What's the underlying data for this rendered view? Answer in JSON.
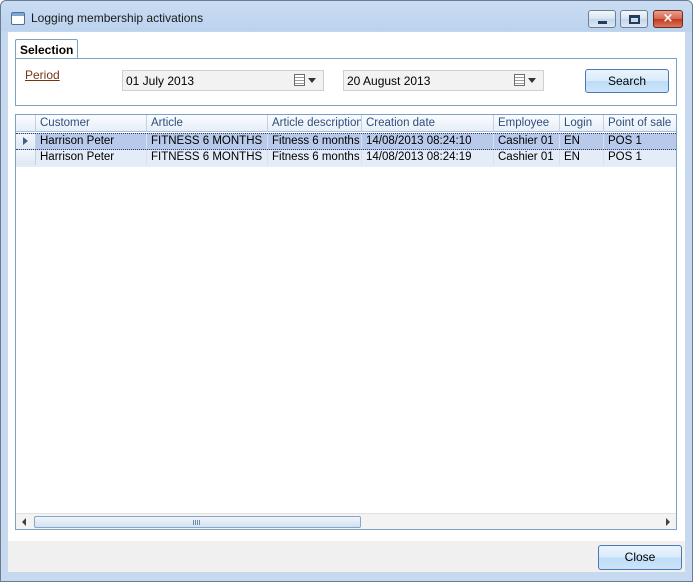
{
  "window": {
    "title": "Logging membership activations",
    "icon": "window-app-icon",
    "controls": {
      "minimize": "minimize-icon",
      "maximize": "maximize-icon",
      "close": "×"
    }
  },
  "selection": {
    "tab_label": "Selection",
    "period_label": "Period",
    "date_from": "01 July 2013",
    "date_to": "20 August 2013",
    "search_label": "Search"
  },
  "grid": {
    "columns": [
      "Customer",
      "Article",
      "Article description",
      "Creation date",
      "Employee",
      "Login",
      "Point of sale"
    ],
    "rows": [
      [
        "Harrison Peter",
        "FITNESS 6 MONTHS",
        "Fitness 6 months",
        "14/08/2013 08:24:10",
        "Cashier 01",
        "EN",
        "POS 1"
      ],
      [
        "Harrison Peter",
        "FITNESS 6 MONTHS",
        "Fitness 6 months",
        "14/08/2013 08:24:19",
        "Cashier 01",
        "EN",
        "POS 1"
      ]
    ],
    "selected_row": 0
  },
  "footer": {
    "close_label": "Close"
  },
  "colors": {
    "selection_row": "#b9c9ea",
    "alt_row": "#e4ecf8",
    "link": "#7a3112",
    "header_text": "#2d4f7c"
  }
}
